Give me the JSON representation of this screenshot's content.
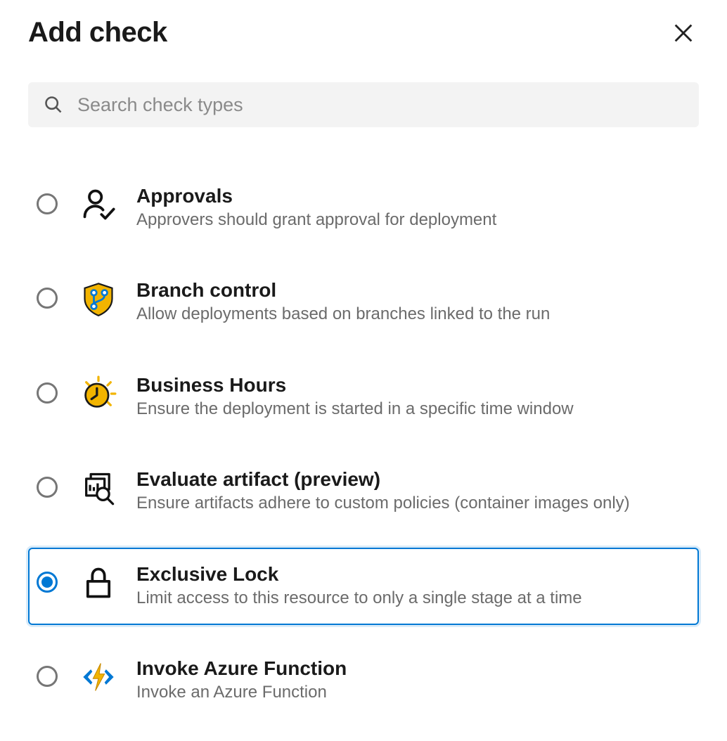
{
  "header": {
    "title": "Add check"
  },
  "search": {
    "placeholder": "Search check types"
  },
  "checks": [
    {
      "title": "Approvals",
      "desc": "Approvers should grant approval for deployment",
      "selected": false
    },
    {
      "title": "Branch control",
      "desc": "Allow deployments based on branches linked to the run",
      "selected": false
    },
    {
      "title": "Business Hours",
      "desc": "Ensure the deployment is started in a specific time window",
      "selected": false
    },
    {
      "title": "Evaluate artifact (preview)",
      "desc": "Ensure artifacts adhere to custom policies (container images only)",
      "selected": false
    },
    {
      "title": "Exclusive Lock",
      "desc": "Limit access to this resource to only a single stage at a time",
      "selected": true
    },
    {
      "title": "Invoke Azure Function",
      "desc": "Invoke an Azure Function",
      "selected": false
    }
  ]
}
